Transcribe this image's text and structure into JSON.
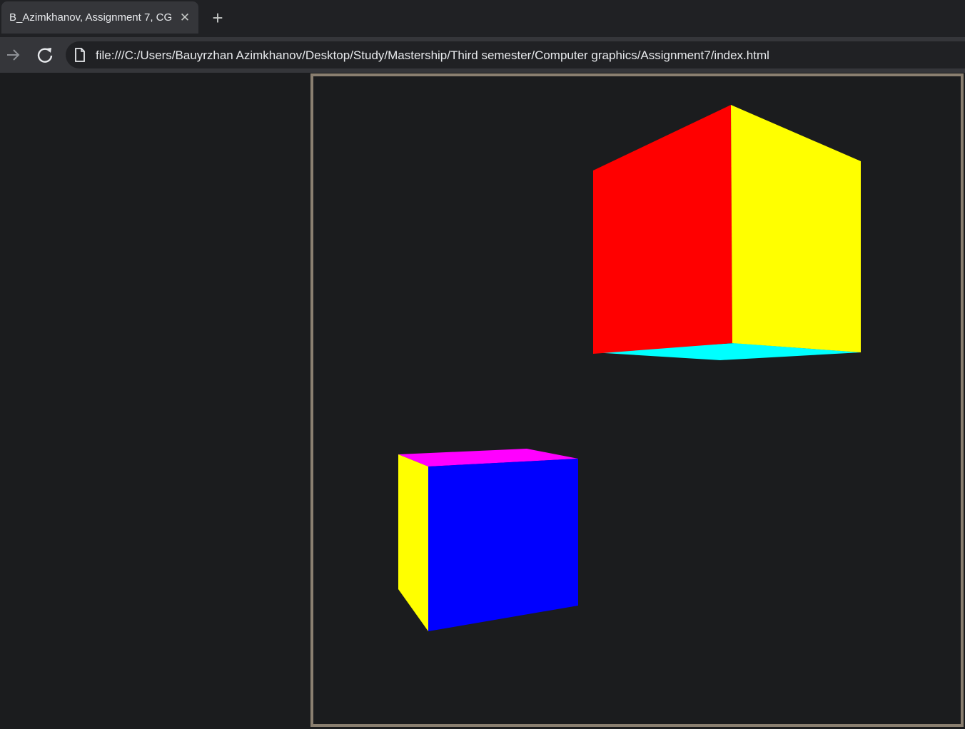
{
  "browser": {
    "tab": {
      "title": "B_Azimkhanov, Assignment 7, CG",
      "close_glyph": "✕"
    },
    "new_tab_glyph": "+",
    "address_bar": {
      "url": "file:///C:/Users/Bauyrzhan Azimkhanov/Desktop/Study/Mastership/Third semester/Computer graphics/Assignment7/index.html"
    },
    "icons": {
      "forward": "arrow-right-icon",
      "reload": "reload-icon",
      "page": "file-icon"
    }
  },
  "scene": {
    "background_color": "#1b1c1e",
    "border_color": "#8a7f70",
    "cubes": [
      {
        "name": "upper-right cube",
        "faces": {
          "left": "#ff0000",
          "right": "#ffff00",
          "bottom": "#00ffff"
        }
      },
      {
        "name": "lower-left cube",
        "faces": {
          "top": "#ff00ff",
          "left": "#ffff00",
          "front": "#0000ff"
        }
      }
    ]
  }
}
